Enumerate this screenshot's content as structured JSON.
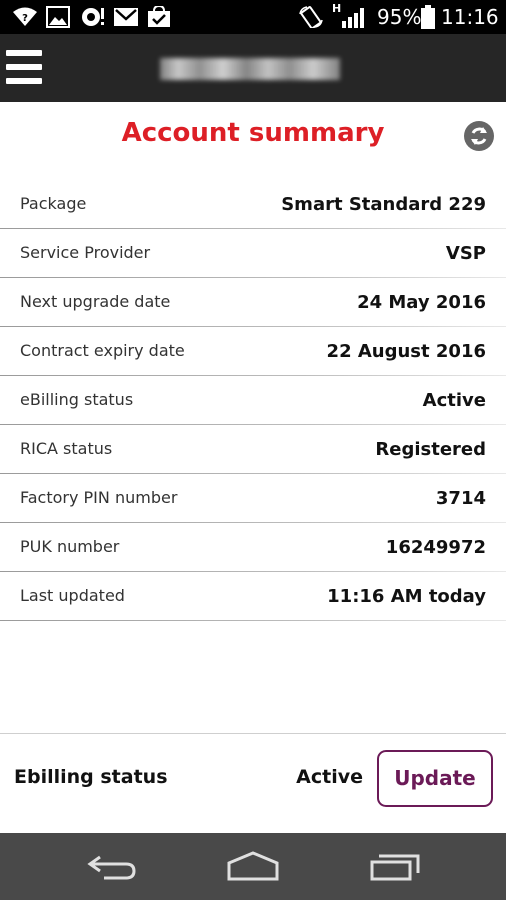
{
  "status_bar": {
    "battery": "95%",
    "network": "H",
    "time": "11:16"
  },
  "header": {
    "title": "Account summary"
  },
  "rows": [
    {
      "label": "Package",
      "value": "Smart Standard 229"
    },
    {
      "label": "Service Provider",
      "value": "VSP"
    },
    {
      "label": "Next upgrade date",
      "value": "24 May 2016"
    },
    {
      "label": "Contract expiry date",
      "value": "22 August 2016"
    },
    {
      "label": "eBilling status",
      "value": "Active"
    },
    {
      "label": "RICA status",
      "value": "Registered"
    },
    {
      "label": "Factory PIN number",
      "value": "3714"
    },
    {
      "label": "PUK number",
      "value": "16249972"
    },
    {
      "label": "Last updated",
      "value": "11:16 AM today"
    }
  ],
  "footer": {
    "label": "Ebilling status",
    "status": "Active",
    "button_label": "Update"
  },
  "colors": {
    "title": "#dd1f26",
    "app_bar": "#262626",
    "button_accent": "#6b1a57",
    "nav_bar": "#494949"
  },
  "icons": {
    "status_bar": [
      "wifi-question-icon",
      "image-icon",
      "sync-alert-icon",
      "gmail-icon",
      "shopping-bag-icon",
      "screen-rotation-icon",
      "signal-icon",
      "battery-icon"
    ],
    "app_bar": [
      "hamburger-menu-icon"
    ],
    "refresh": "refresh-icon",
    "nav": [
      "back-icon",
      "home-icon",
      "recent-apps-icon"
    ]
  }
}
